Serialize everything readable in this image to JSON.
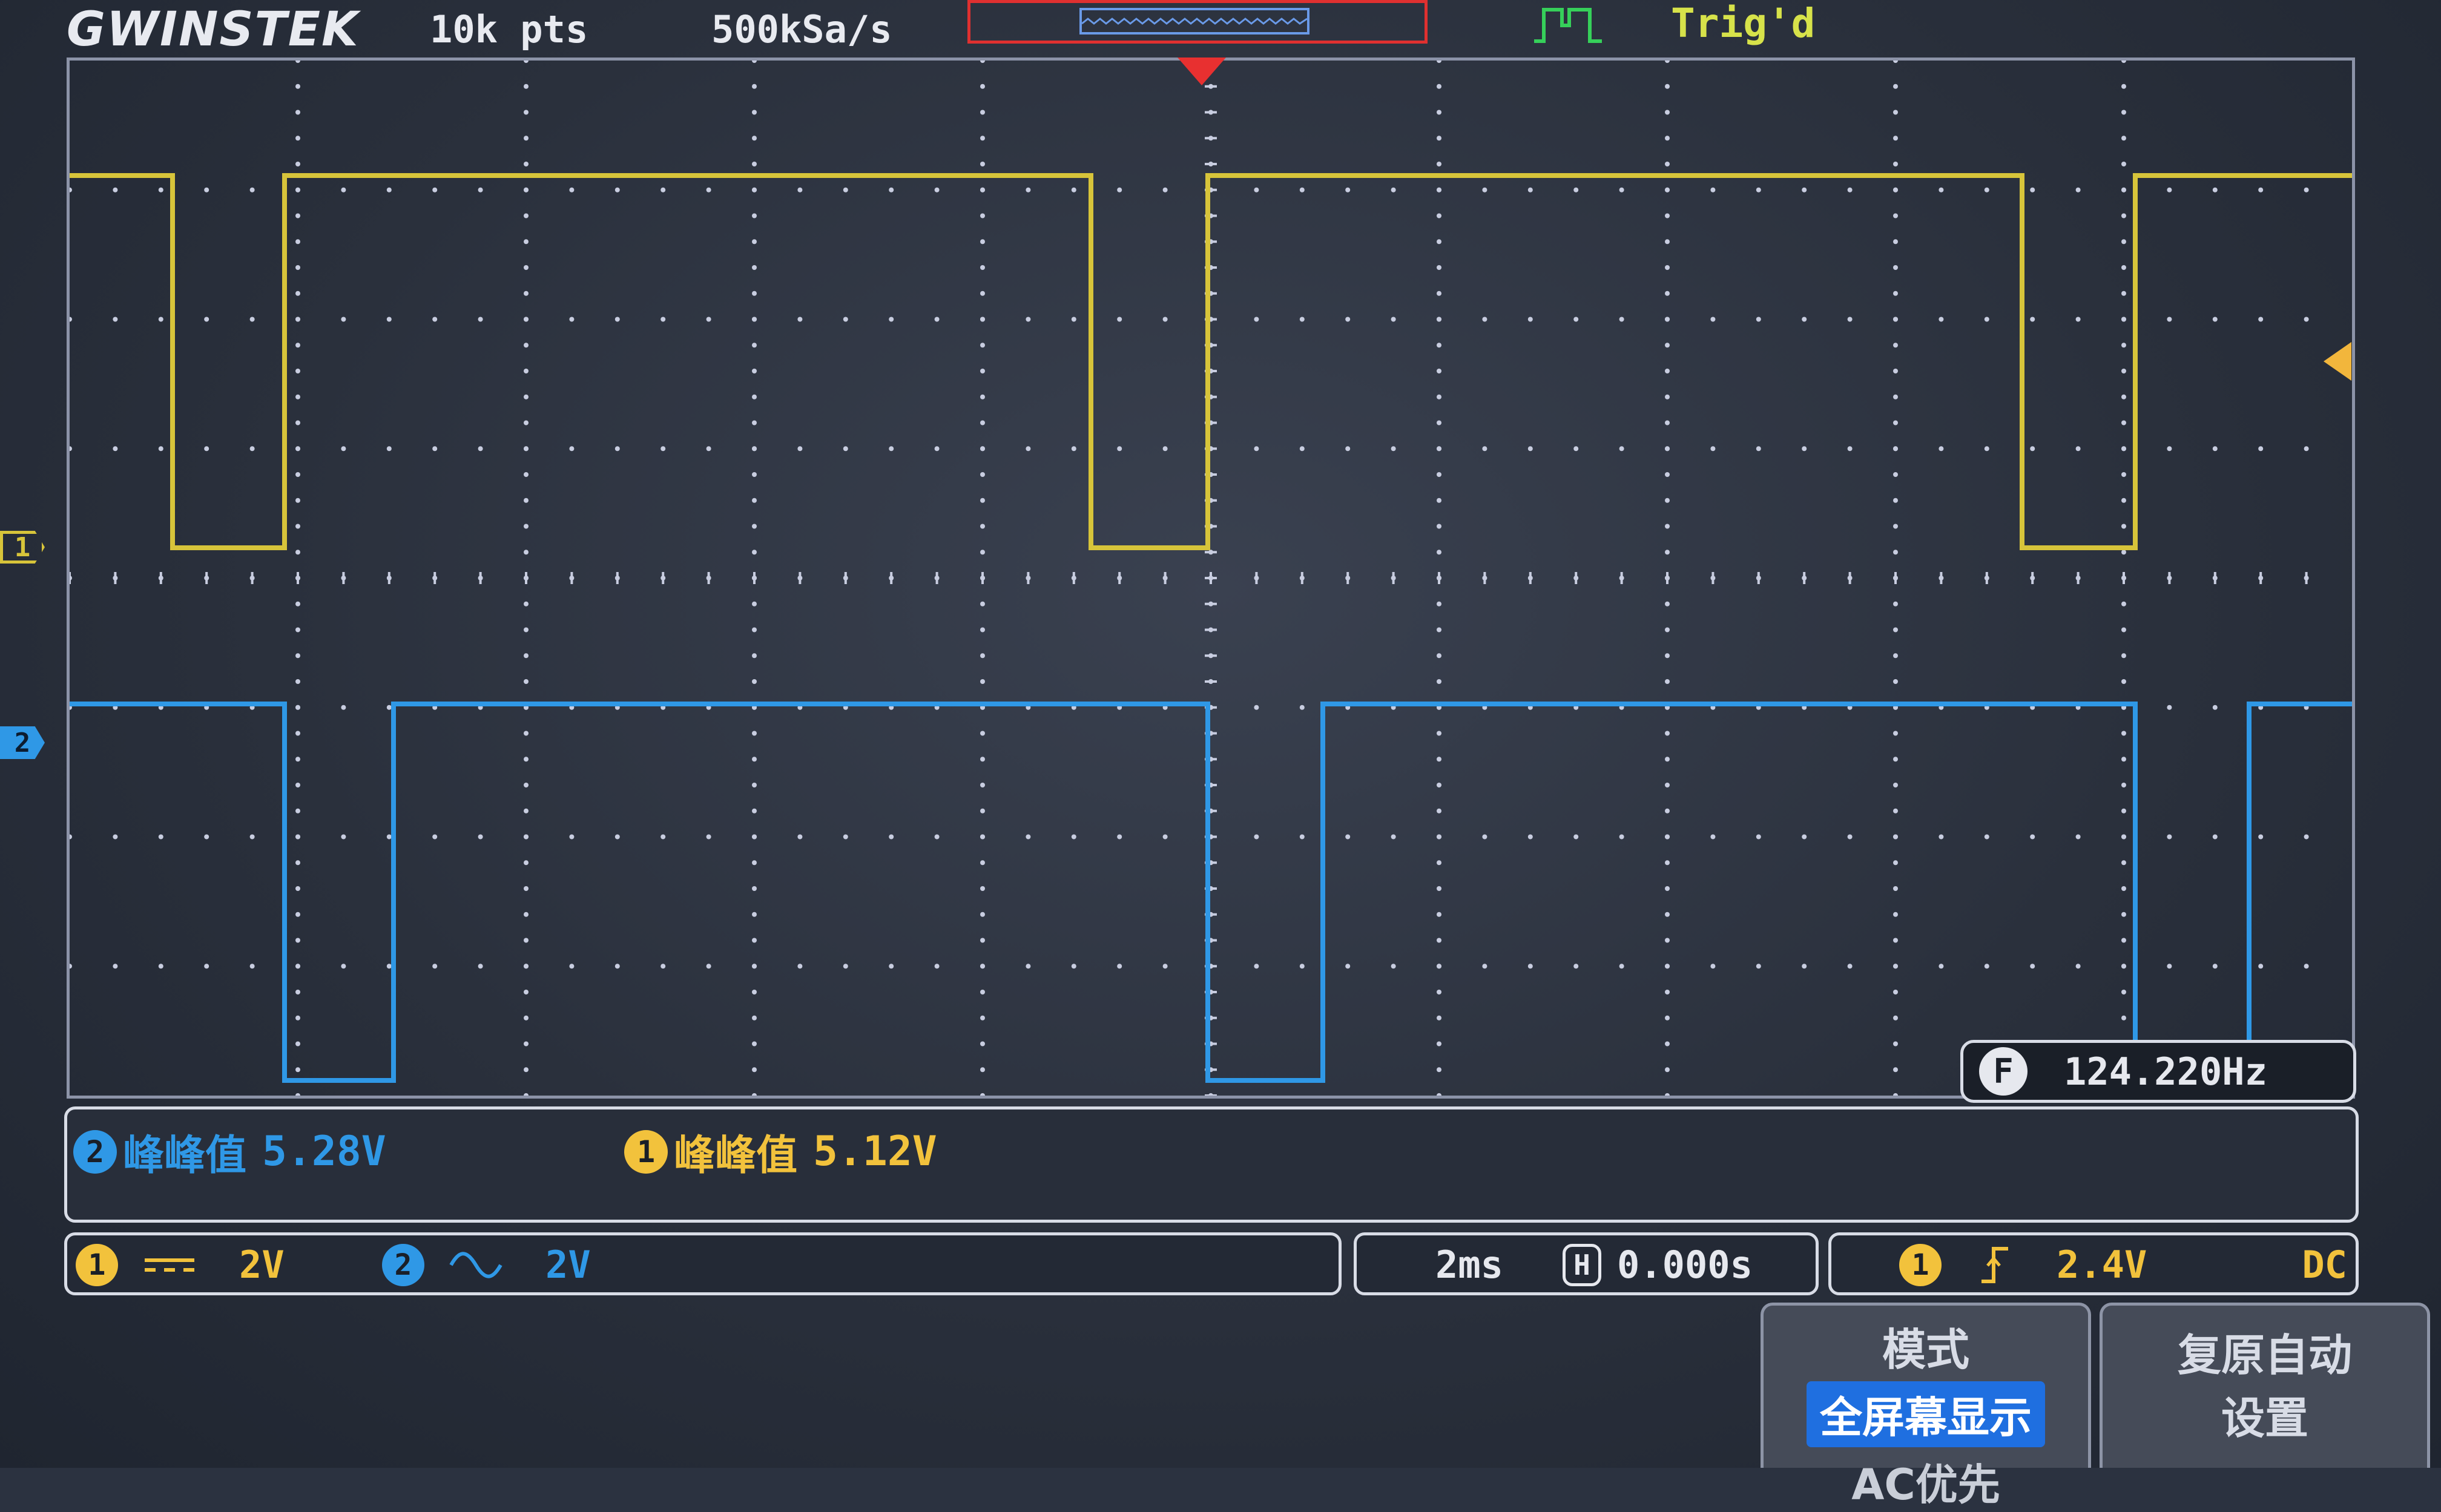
{
  "brand": "GWINSTEK",
  "header": {
    "record_length": "10k pts",
    "sample_rate": "500kSa/s",
    "trigger_status": "Trig'd"
  },
  "colors": {
    "ch1": "#d7c43a",
    "ch2": "#2f98e6",
    "trigger_marker": "#e83030",
    "menu_highlight": "#1f6fe0"
  },
  "channels": {
    "ch1_label": "1",
    "ch2_label": "2"
  },
  "frequency": {
    "badge": "F",
    "value": "124.220Hz"
  },
  "measurements": [
    {
      "channel": "2",
      "name": "峰峰值",
      "value": "5.28V"
    },
    {
      "channel": "1",
      "name": "峰峰值",
      "value": "5.12V"
    }
  ],
  "status": {
    "ch1_badge": "1",
    "ch1_coupling_icon": "dc-coupling-icon",
    "ch1_scale": "2V",
    "ch2_badge": "2",
    "ch2_coupling_icon": "ac-coupling-icon",
    "ch2_scale": "2V",
    "timebase": "2ms",
    "h_badge": "H",
    "h_position": "0.000s",
    "trig_source": "1",
    "trig_slope_icon": "rising-edge-icon",
    "trig_level": "2.4V",
    "trig_coupling": "DC"
  },
  "softkeys": {
    "mode_title": "模式",
    "mode_selected": "全屏幕显示",
    "mode_option": "AC优先",
    "restore_line1": "复原自动",
    "restore_line2": "设置"
  }
}
